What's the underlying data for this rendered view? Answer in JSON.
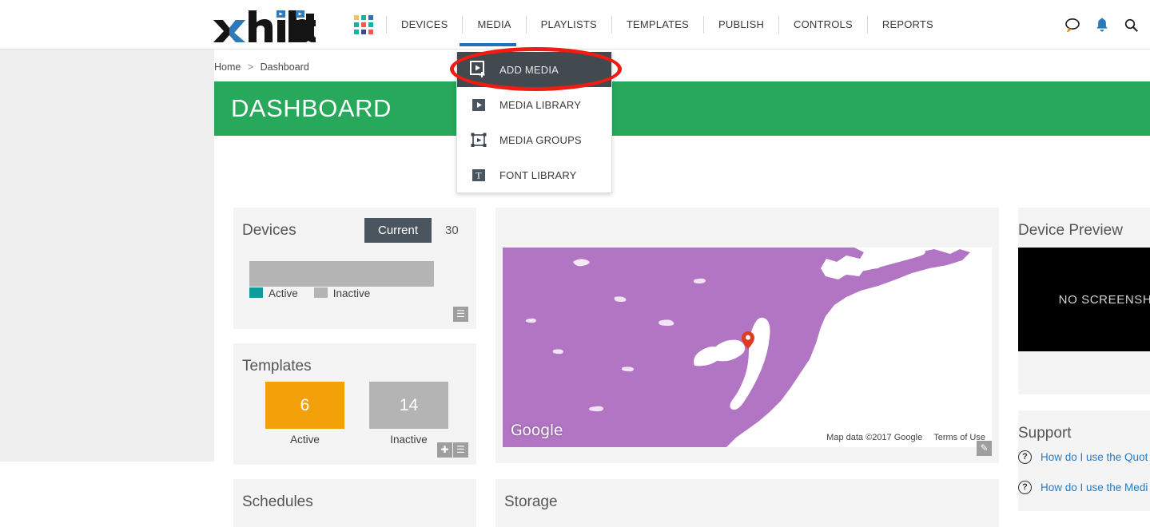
{
  "brand": {
    "name": "xhibit",
    "logo_accent": "#2e7ab8"
  },
  "nav": {
    "grid_icon": "apps-grid-icon",
    "grid_colors": [
      "#eec16a",
      "#18b0a8",
      "#2f6fb5",
      "#18b0a8",
      "#ef5a4c",
      "#18b0a8",
      "#18b0a8",
      "#3b4a8c",
      "#ef5a4c"
    ],
    "items": [
      {
        "label": "DEVICES",
        "active": false
      },
      {
        "label": "MEDIA",
        "active": true
      },
      {
        "label": "PLAYLISTS",
        "active": false
      },
      {
        "label": "TEMPLATES",
        "active": false
      },
      {
        "label": "PUBLISH",
        "active": false
      },
      {
        "label": "CONTROLS",
        "active": false
      },
      {
        "label": "REPORTS",
        "active": false
      }
    ],
    "active_indicator_color": "#1f72b8"
  },
  "top_icons": [
    {
      "name": "chat-icon",
      "color": "#1a1a1a"
    },
    {
      "name": "bell-icon",
      "color": "#2a7bbd"
    },
    {
      "name": "search-icon",
      "color": "#1a1a1a"
    }
  ],
  "media_menu": {
    "items": [
      {
        "label": "ADD MEDIA",
        "icon": "add-media-icon",
        "highlighted": true
      },
      {
        "label": "MEDIA LIBRARY",
        "icon": "media-library-icon",
        "highlighted": false
      },
      {
        "label": "MEDIA GROUPS",
        "icon": "media-groups-icon",
        "highlighted": false
      },
      {
        "label": "FONT LIBRARY",
        "icon": "font-library-icon",
        "highlighted": false
      }
    ],
    "annotation_color": "#ee1c12"
  },
  "breadcrumb": {
    "home": "Home",
    "separator": ">",
    "current": "Dashboard"
  },
  "banner": {
    "title": "DASHBOARD",
    "color": "#27a85b"
  },
  "devices_card": {
    "title": "Devices",
    "tabs": [
      {
        "label": "Current",
        "active": true
      },
      {
        "label": "30",
        "active": false
      }
    ],
    "legend": [
      {
        "label": "Active",
        "color": "#0f9b9b"
      },
      {
        "label": "Inactive",
        "color": "#b4b4b4"
      }
    ],
    "menu_icon": "hamburger-icon"
  },
  "templates_card": {
    "title": "Templates",
    "tiles": [
      {
        "value": "6",
        "label": "Active",
        "color": "#f3a009"
      },
      {
        "value": "14",
        "label": "Inactive",
        "color": "#b4b4b4"
      }
    ],
    "add_icon": "plus-icon",
    "menu_icon": "hamburger-icon"
  },
  "map_card": {
    "google_watermark": "Google",
    "attribution": "Map data ©2017 Google",
    "terms": "Terms of Use",
    "pin_icon": "map-pin-icon",
    "edit_icon": "edit-icon",
    "land_color": "#b275c4",
    "water_color": "#ffffff"
  },
  "schedules_card": {
    "title": "Schedules"
  },
  "storage_card": {
    "title": "Storage"
  },
  "device_preview_card": {
    "title": "Device Preview",
    "placeholder": "NO SCREENSHOT"
  },
  "support_card": {
    "title": "Support",
    "links": [
      {
        "icon": "question-icon",
        "label": "How do I use the Quot"
      },
      {
        "icon": "question-icon",
        "label": "How do I use the Medi"
      }
    ]
  }
}
